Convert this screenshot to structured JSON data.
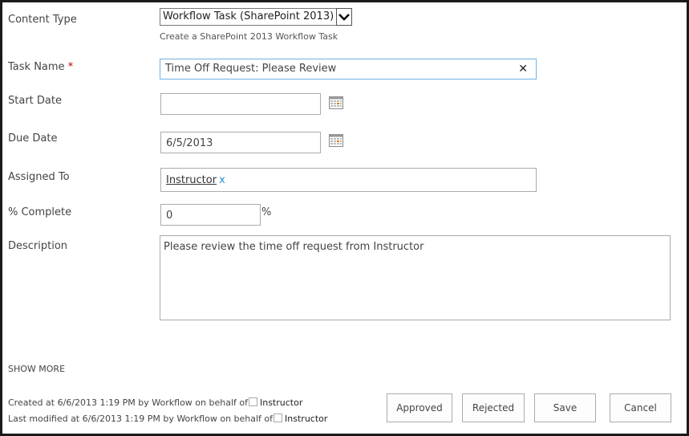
{
  "form": {
    "content_type": {
      "label": "Content Type",
      "value": "Workflow Task (SharePoint 2013)",
      "hint": "Create a SharePoint 2013 Workflow Task"
    },
    "task_name": {
      "label": "Task Name",
      "required_mark": "*",
      "value": "Time Off Request: Please Review",
      "clear_glyph": "✕"
    },
    "start_date": {
      "label": "Start Date",
      "value": ""
    },
    "due_date": {
      "label": "Due Date",
      "value": "6/5/2013"
    },
    "assigned_to": {
      "label": "Assigned To",
      "person": "Instructor",
      "remove_glyph": "x"
    },
    "percent_complete": {
      "label": "% Complete",
      "value": "0",
      "unit": "%"
    },
    "description": {
      "label": "Description",
      "value": "Please review the time off request from Instructor"
    },
    "show_more": "SHOW MORE"
  },
  "footer": {
    "created": "Created at 6/6/2013 1:19 PM  by Workflow on behalf of",
    "created_by": "Instructor",
    "modified": "Last modified at 6/6/2013 1:19 PM  by Workflow on behalf of",
    "modified_by": "Instructor"
  },
  "buttons": {
    "approved": "Approved",
    "rejected": "Rejected",
    "save": "Save",
    "cancel": "Cancel"
  },
  "icons": {
    "calendar": "calendar-icon",
    "dropdown": "chevron-down-icon"
  },
  "colors": {
    "focus_border": "#6fb2e6",
    "required": "#bf0000",
    "people_remove": "#2a8dd4"
  }
}
